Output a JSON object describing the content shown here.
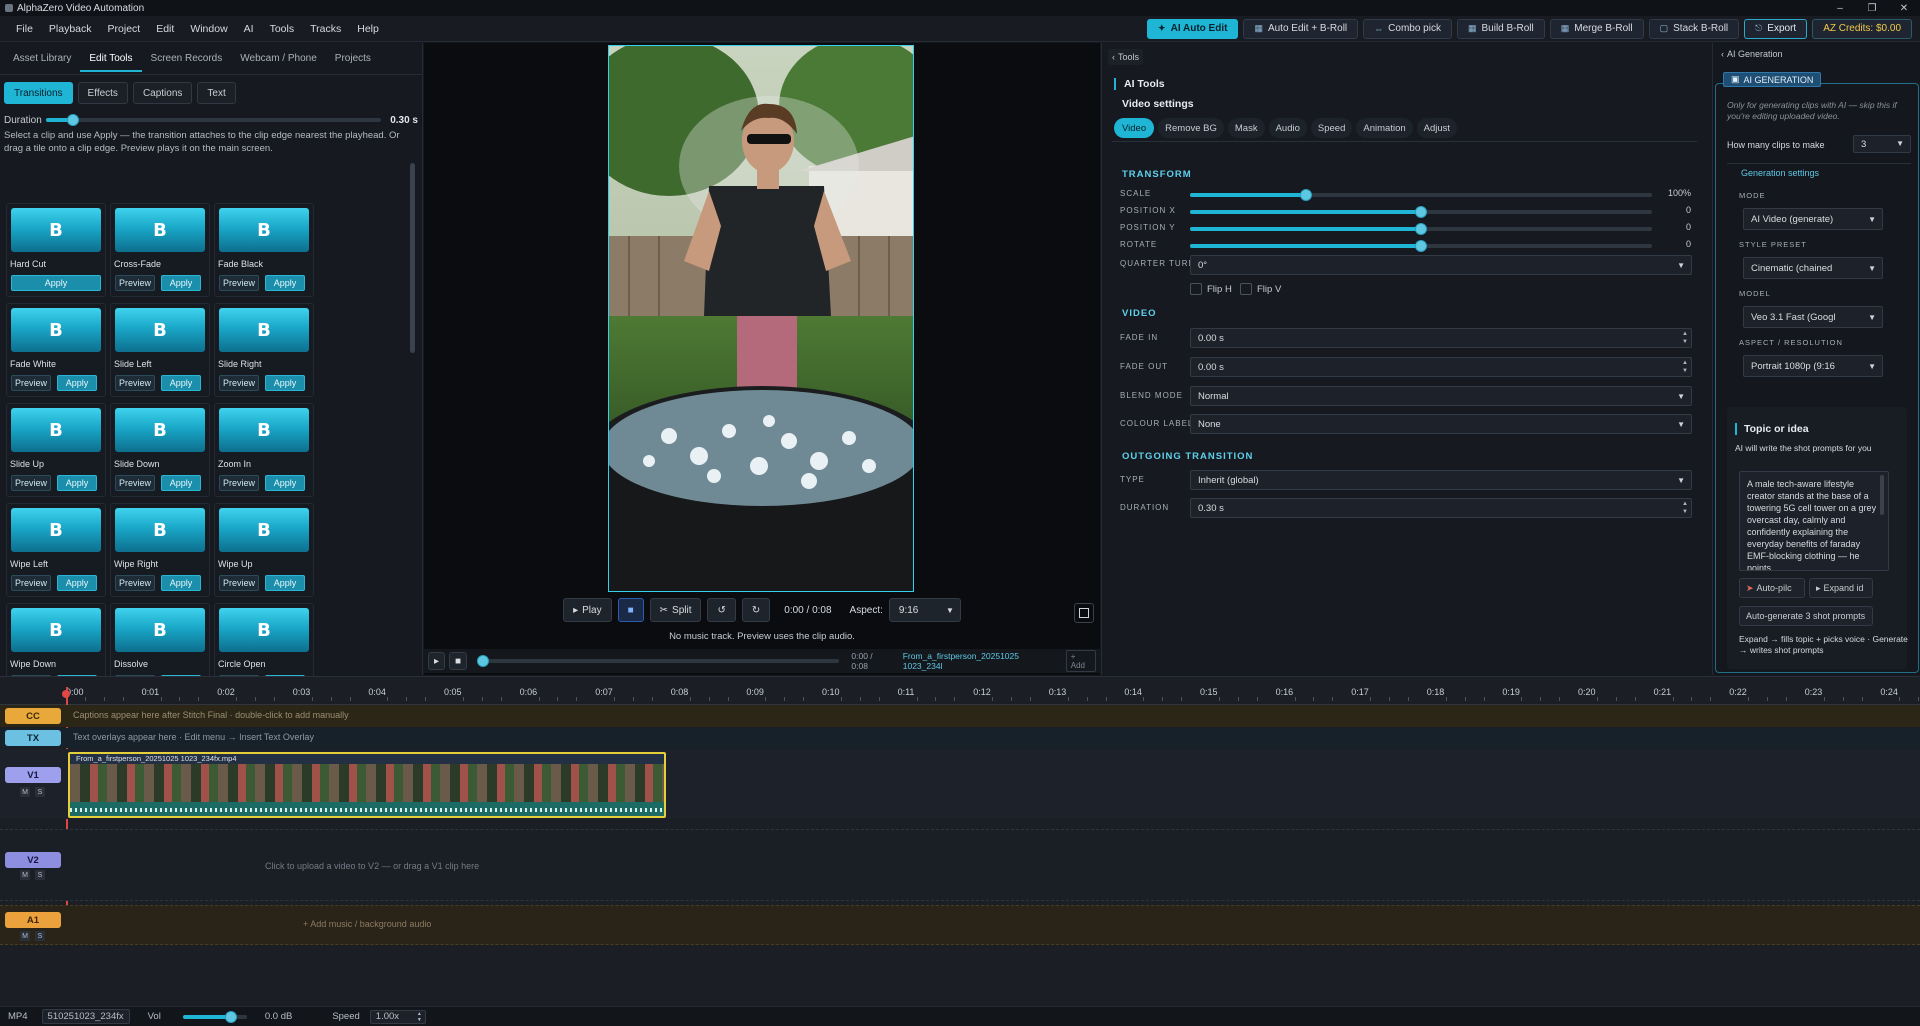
{
  "app": {
    "title": "AlphaZero Video Automation"
  },
  "menu": [
    "File",
    "Playback",
    "Project",
    "Edit",
    "Window",
    "AI",
    "Tools",
    "Tracks",
    "Help"
  ],
  "toolbar": {
    "ai_auto_edit": "AI Auto Edit",
    "auto_edit_broll": "Auto Edit + B-Roll",
    "combo_pick": "Combo pick",
    "build_broll": "Build B-Roll",
    "merge_broll": "Merge B-Roll",
    "stack_broll": "Stack B-Roll",
    "export": "Export",
    "credits": "AZ Credits: $0.00"
  },
  "left": {
    "tabs": [
      "Asset Library",
      "Edit Tools",
      "Screen Records",
      "Webcam / Phone",
      "Projects"
    ],
    "subtabs": [
      "Transitions",
      "Effects",
      "Captions",
      "Text"
    ],
    "duration_label": "Duration",
    "duration_value": "0.30 s",
    "duration_level": 0.08,
    "help": "Select a clip and use Apply — the transition attaches to the clip edge nearest the playhead. Or drag a tile onto a clip edge. Preview plays it on the main screen.",
    "thumb_letter": "B",
    "preview_label": "Preview",
    "apply_label": "Apply",
    "transitions": [
      "Hard Cut",
      "Cross-Fade",
      "Fade Black",
      "Fade White",
      "Slide Left",
      "Slide Right",
      "Slide Up",
      "Slide Down",
      "Zoom In",
      "Wipe Left",
      "Wipe Right",
      "Wipe Up",
      "Wipe Down",
      "Dissolve",
      "Circle Open"
    ]
  },
  "preview": {
    "play": "Play",
    "split": "Split",
    "time": "0:00 / 0:08",
    "aspect_label": "Aspect:",
    "aspect_value": "9:16",
    "no_music": "No music track. Preview uses the clip audio.",
    "scrub_time": "0:00 / 0:08",
    "file": "From_a_firstperson_20251025 1023_234l",
    "add": "+ Add"
  },
  "inspector": {
    "back": "Tools",
    "title": "AI Tools",
    "subtitle": "Video settings",
    "tabs": [
      "Video",
      "Remove BG",
      "Mask",
      "Audio",
      "Speed",
      "Animation",
      "Adjust"
    ],
    "transform_title": "TRANSFORM",
    "scale_label": "SCALE",
    "scale_value": "100%",
    "scale_level": 0.25,
    "posx_label": "POSITION X",
    "posx_value": "0",
    "posx_level": 0.5,
    "posy_label": "POSITION Y",
    "posy_value": "0",
    "posy_level": 0.5,
    "rotate_label": "ROTATE",
    "rotate_value": "0",
    "rotate_level": 0.5,
    "quarter_label": "QUARTER TURN",
    "quarter_value": "0°",
    "fliph": "Flip H",
    "flipv": "Flip V",
    "video_title": "VIDEO",
    "fadein_label": "FADE IN",
    "fadein_value": "0.00 s",
    "fadeout_label": "FADE OUT",
    "fadeout_value": "0.00 s",
    "blend_label": "BLEND MODE",
    "blend_value": "Normal",
    "colour_label": "COLOUR LABEL",
    "colour_value": "None",
    "outgoing_title": "OUTGOING TRANSITION",
    "type_label": "TYPE",
    "type_value": "Inherit (global)",
    "duration_label": "DURATION",
    "duration_value": "0.30 s"
  },
  "aigen": {
    "back": "AI Generation",
    "header": "AI GENERATION",
    "note": "Only for generating clips with AI — skip this if you're editing uploaded video.",
    "howmany_label": "How many clips to make",
    "howmany_value": "3",
    "gen_settings": "Generation settings",
    "mode_label": "MODE",
    "mode_value": "AI Video (generate)",
    "style_label": "STYLE PRESET",
    "style_value": "Cinematic (chained",
    "model_label": "MODEL",
    "model_value": "Veo 3.1 Fast (Googl",
    "aspect_label": "ASPECT / RESOLUTION",
    "aspect_value": "Portrait 1080p (9:16",
    "topic_title": "Topic or idea",
    "topic_help": "AI will write the shot prompts for you",
    "topic_text": "A male tech-aware lifestyle creator stands at the base of a towering 5G cell tower on a grey overcast day, calmly and confidently explaining the everyday benefits of faraday EMF-blocking clothing — he points",
    "autopilot": "Auto-pilc",
    "expand": "Expand id",
    "autogen": "Auto-generate 3 shot prompts",
    "footer": "Expand → fills topic + picks voice · Generate → writes shot prompts"
  },
  "timeline": {
    "ticks": [
      "0:00",
      "0:01",
      "0:02",
      "0:03",
      "0:04",
      "0:05",
      "0:06",
      "0:07",
      "0:08",
      "0:09",
      "0:10",
      "0:11",
      "0:12",
      "0:13",
      "0:14",
      "0:15",
      "0:16",
      "0:17",
      "0:18",
      "0:19",
      "0:20",
      "0:21",
      "0:22",
      "0:23",
      "0:24"
    ],
    "cc_label": "CC",
    "cc_text": "Captions appear here after Stitch Final · double-click to add manually",
    "tx_label": "TX",
    "tx_text": "Text overlays appear here · Edit menu → Insert Text Overlay",
    "v1_label": "V1",
    "v1_clip": "From_a_firstperson_20251025 1023_234fx.mp4",
    "v2_label": "V2",
    "v2_text": "Click to upload a video to V2 — or drag a V1 clip here",
    "a1_label": "A1",
    "a1_text": "+ Add music / background audio",
    "m": "M",
    "s": "S"
  },
  "status": {
    "format": "MP4",
    "file": "510251023_234fx",
    "vol_label": "Vol",
    "vol_value": "0.0 dB",
    "vol_level": 0.75,
    "speed_label": "Speed",
    "speed_value": "1.00x"
  },
  "colors": {
    "accent": "#1fb6d6",
    "cc": "#e0a030",
    "tx": "#5ab8e0",
    "v": "#8f8fe6",
    "a": "#e0a030"
  }
}
